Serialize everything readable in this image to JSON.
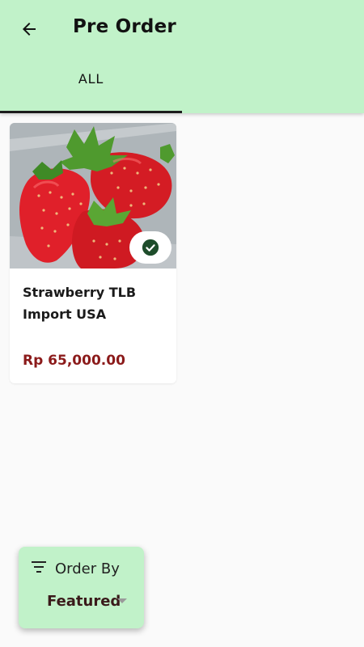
{
  "header": {
    "title": "Pre Order",
    "back_icon": "arrow-left-icon",
    "background_color": "#c1f2c9"
  },
  "tabs": [
    {
      "label": "ALL",
      "selected": true
    }
  ],
  "products": [
    {
      "name": "Strawberry TLB Import USA",
      "price": "Rp 65,000.00",
      "image": "strawberries-photo",
      "badge_icon": "check-circle-icon",
      "price_color": "#8b1a1a"
    }
  ],
  "order_by": {
    "label": "Order By",
    "value": "Featured",
    "icon": "filter-icon",
    "dropdown_icon": "caret-down-icon"
  }
}
